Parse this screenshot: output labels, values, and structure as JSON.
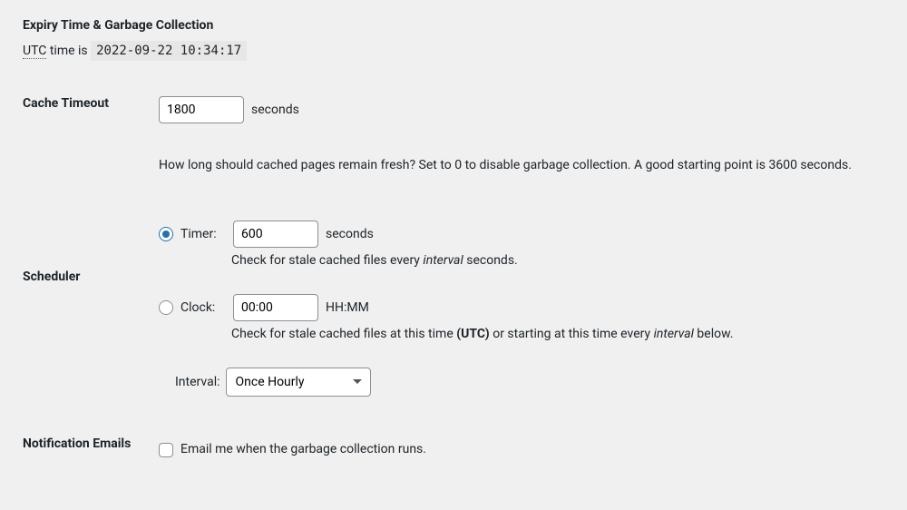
{
  "section_title": "Expiry Time & Garbage Collection",
  "utc": {
    "acronym": "UTC",
    "prefix_text": " time is ",
    "timestamp": "2022-09-22 10:34:17"
  },
  "cache_timeout": {
    "label": "Cache Timeout",
    "value": "1800",
    "unit": "seconds",
    "description": "How long should cached pages remain fresh? Set to 0 to disable garbage collection. A good starting point is 3600 seconds."
  },
  "scheduler": {
    "label": "Scheduler",
    "timer": {
      "radio_label": "Timer:",
      "value": "600",
      "unit": "seconds",
      "desc_prefix": "Check for stale cached files every ",
      "desc_em": "interval",
      "desc_suffix": " seconds."
    },
    "clock": {
      "radio_label": "Clock:",
      "value": "00:00",
      "unit": "HH:MM",
      "desc_prefix": "Check for stale cached files at this time ",
      "desc_bold": "(UTC)",
      "desc_mid": " or starting at this time every ",
      "desc_em": "interval",
      "desc_suffix": " below."
    },
    "interval": {
      "label": "Interval:",
      "selected": "Once Hourly"
    }
  },
  "notification": {
    "label": "Notification Emails",
    "checkbox_label": "Email me when the garbage collection runs."
  }
}
